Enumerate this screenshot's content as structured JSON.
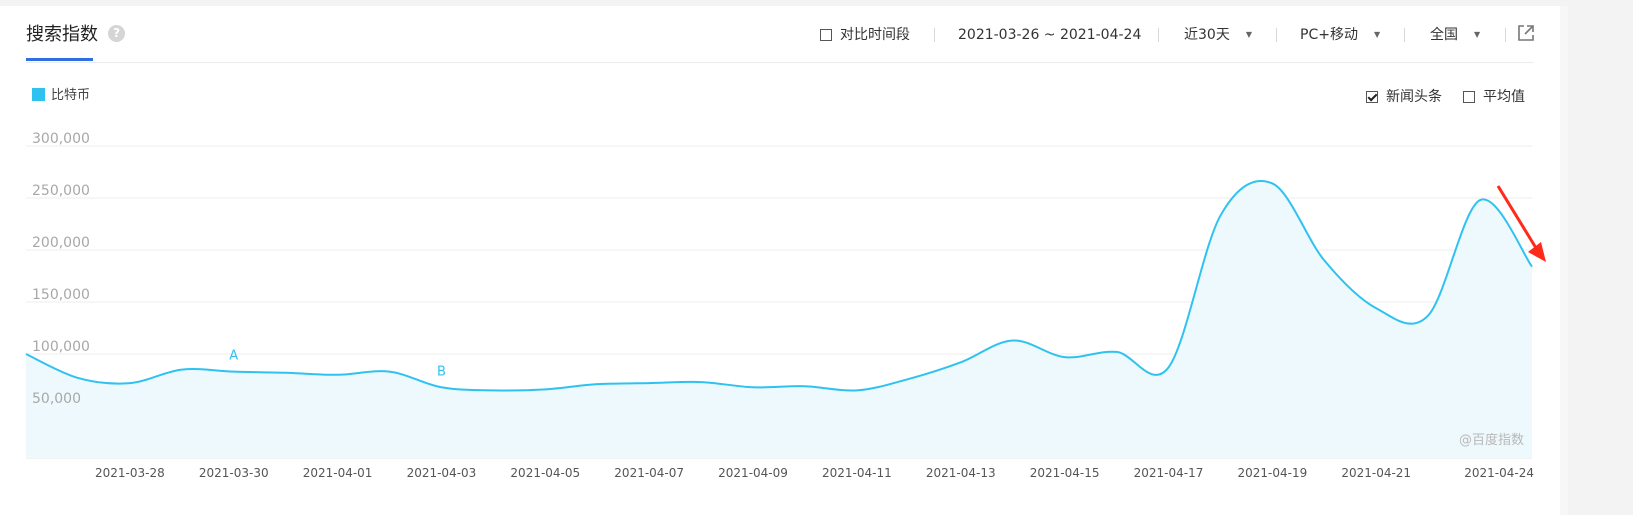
{
  "header": {
    "title": "搜索指数",
    "help_icon": "question-icon",
    "compare_label": "对比时间段",
    "date_range": "2021-03-26 ~ 2021-04-24",
    "period": "近30天",
    "device": "PC+移动",
    "region": "全国",
    "share_icon": "external-link-icon"
  },
  "options": {
    "news_label": "新闻头条",
    "news_checked": true,
    "avg_label": "平均值",
    "avg_checked": false
  },
  "watermark": "@百度指数",
  "colors": {
    "series": "#2fc2f0",
    "accent": "#2f6fe0",
    "arrow": "#ff2a1a"
  },
  "chart_data": {
    "type": "area",
    "title": "",
    "xlabel": "",
    "ylabel": "",
    "ylim": [
      0,
      300000
    ],
    "yticks": [
      "50,000",
      "100,000",
      "150,000",
      "200,000",
      "250,000",
      "300,000"
    ],
    "ytick_values": [
      50000,
      100000,
      150000,
      200000,
      250000,
      300000
    ],
    "xtick_labels": [
      "2021-03-28",
      "2021-03-30",
      "2021-04-01",
      "2021-04-03",
      "2021-04-05",
      "2021-04-07",
      "2021-04-09",
      "2021-04-11",
      "2021-04-13",
      "2021-04-15",
      "2021-04-17",
      "2021-04-19",
      "2021-04-21",
      "2021-04-24"
    ],
    "grid": true,
    "legend_position": "top-left",
    "categories": [
      "2021-03-26",
      "2021-03-27",
      "2021-03-28",
      "2021-03-29",
      "2021-03-30",
      "2021-03-31",
      "2021-04-01",
      "2021-04-02",
      "2021-04-03",
      "2021-04-04",
      "2021-04-05",
      "2021-04-06",
      "2021-04-07",
      "2021-04-08",
      "2021-04-09",
      "2021-04-10",
      "2021-04-11",
      "2021-04-12",
      "2021-04-13",
      "2021-04-14",
      "2021-04-15",
      "2021-04-16",
      "2021-04-17",
      "2021-04-18",
      "2021-04-19",
      "2021-04-20",
      "2021-04-21",
      "2021-04-22",
      "2021-04-23",
      "2021-04-24"
    ],
    "series": [
      {
        "name": "比特币",
        "values": [
          100000,
          77000,
          72000,
          85000,
          83000,
          82000,
          80000,
          83000,
          68000,
          65000,
          66000,
          71000,
          72000,
          73000,
          68000,
          69000,
          65000,
          76000,
          92000,
          113000,
          97000,
          102000,
          87000,
          233000,
          264000,
          190000,
          144000,
          137000,
          248000,
          184000
        ]
      }
    ],
    "annotations": [
      {
        "label": "A",
        "x": "2021-03-30"
      },
      {
        "label": "B",
        "x": "2021-04-03"
      }
    ]
  }
}
